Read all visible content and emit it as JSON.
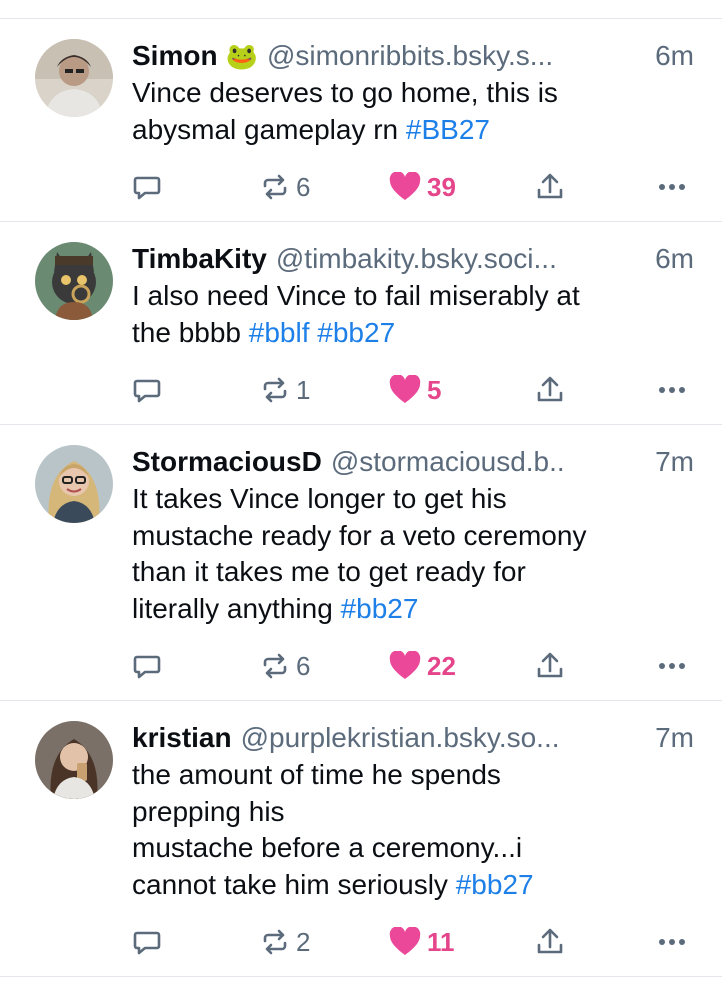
{
  "colors": {
    "accent_link": "#1d7fe8",
    "like_pink": "#ec4899",
    "muted_text": "#5b6b7c",
    "divider": "#e3e7ec"
  },
  "posts": [
    {
      "name": "Simon",
      "emoji": "🐸",
      "handle": "@simonribbits.bsky.s...",
      "time": "6m",
      "text_plain": "Vince deserves to go home, this is\nabysmal gameplay rn ",
      "tags": "#BB27",
      "reposts": "6",
      "likes": "39",
      "avatar_icon": "person-photo"
    },
    {
      "name": "TimbaKity",
      "emoji": "",
      "handle": "@timbakity.bsky.soci...",
      "time": "6m",
      "text_plain": "I also need Vince to fail miserably at\nthe bbbb ",
      "tags": "#bblf #bb27",
      "reposts": "1",
      "likes": "5",
      "avatar_icon": "cat-illustration"
    },
    {
      "name": "StormaciousD",
      "emoji": "",
      "handle": "@stormaciousd.b..",
      "time": "7m",
      "text_plain": "It takes Vince longer to get his\nmustache ready for a veto ceremony\nthan it takes me to get ready for\nliterally anything ",
      "tags": "#bb27",
      "reposts": "6",
      "likes": "22",
      "avatar_icon": "person-photo"
    },
    {
      "name": "kristian",
      "emoji": "",
      "handle": "@purplekristian.bsky.so...",
      "time": "7m",
      "text_plain": "the amount of time he spends\nprepping his\nmustache before a ceremony...i\ncannot take him seriously ",
      "tags": "#bb27",
      "reposts": "2",
      "likes": "11",
      "avatar_icon": "person-photo"
    }
  ]
}
